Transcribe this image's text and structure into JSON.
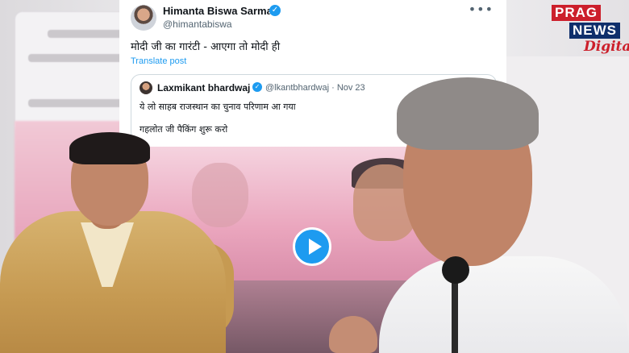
{
  "tweet": {
    "author_name": "Himanta Biswa Sarma",
    "handle": "@himantabiswa",
    "verified_icon": "verified-badge-icon",
    "more_icon": "more-options-icon",
    "more_glyph": "•••",
    "text": "मोदी जी का गारंटी - आएगा तो मोदी ही",
    "translate_label": "Translate post",
    "quoted": {
      "author_name": "Laxmikant bhardwaj",
      "handle_date": "@lkantbhardwaj · Nov 23",
      "line1": "ये लो साहब राजस्थान का चुनाव परिणाम आ गया",
      "line2": "गहलोत जी पैकिंग शुरू करो",
      "play_icon": "play-button-icon"
    }
  },
  "logo": {
    "top": "PRAG",
    "middle": "NEWS",
    "bottom": "Digital"
  },
  "colors": {
    "twitter_blue": "#1d9bf0",
    "logo_red": "#cc1f2b",
    "logo_navy": "#0f2f6b"
  }
}
